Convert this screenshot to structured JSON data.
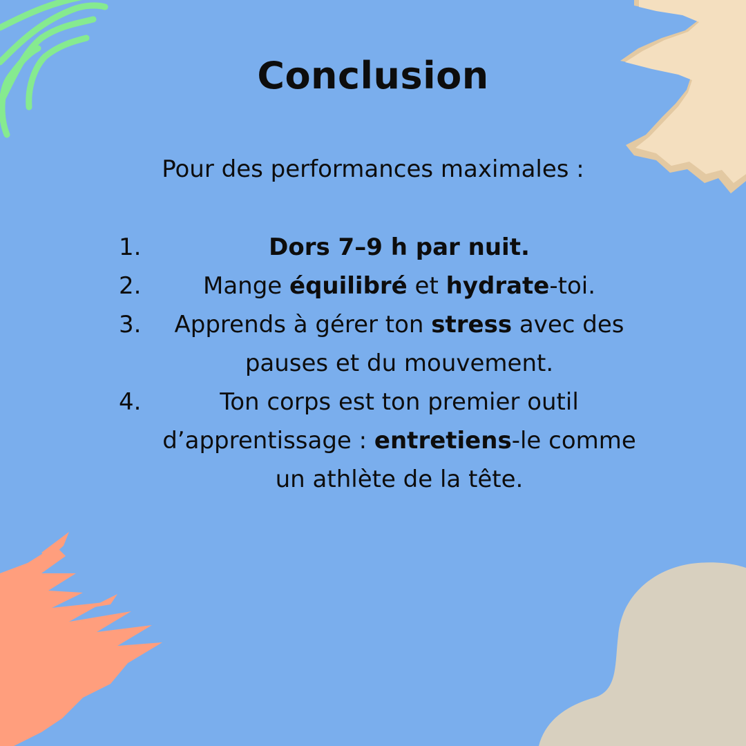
{
  "title": "Conclusion",
  "intro": "Pour des performances maximales :",
  "items": [
    {
      "number": "1.",
      "parts": [
        {
          "text": "Dors 7–9 h par nuit.",
          "bold": true
        }
      ]
    },
    {
      "number": "2.",
      "parts": [
        {
          "text": "Mange ",
          "bold": false
        },
        {
          "text": "équilibré",
          "bold": true
        },
        {
          "text": " et ",
          "bold": false
        },
        {
          "text": "hydrate",
          "bold": true
        },
        {
          "text": "-toi.",
          "bold": false
        }
      ]
    },
    {
      "number": "3.",
      "parts": [
        {
          "text": "Apprends à gérer ton ",
          "bold": false
        },
        {
          "text": "stress",
          "bold": true
        },
        {
          "text": " avec des pauses et du mouvement.",
          "bold": false
        }
      ]
    },
    {
      "number": "4.",
      "parts": [
        {
          "text": "Ton corps est ton premier outil d’apprentissage : ",
          "bold": false
        },
        {
          "text": "entretiens",
          "bold": true
        },
        {
          "text": "-le comme un athlète de la tête.",
          "bold": false
        }
      ]
    }
  ],
  "colors": {
    "background": "#7aaeed",
    "text": "#0d0d0d",
    "green_waves": "#86ea90",
    "cream_brush": "#f4dfbf",
    "salmon_brush": "#ff9e7d",
    "beige_blob": "#d8d0bf"
  },
  "decorations": [
    "green-wave-lines",
    "cream-brush-stroke",
    "salmon-brush-stroke",
    "beige-blob"
  ]
}
